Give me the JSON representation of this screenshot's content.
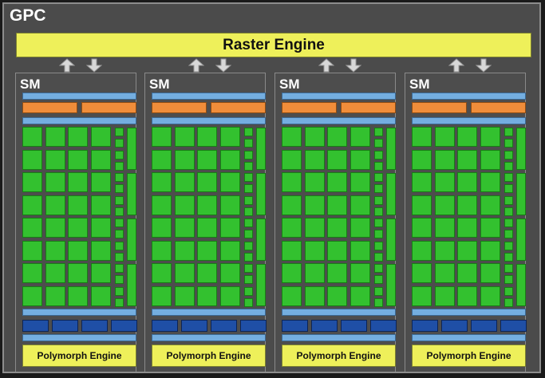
{
  "gpc": {
    "title": "GPC"
  },
  "raster_engine": {
    "label": "Raster Engine"
  },
  "sms": [
    {
      "title": "SM",
      "polymorph_label": "Polymorph Engine"
    },
    {
      "title": "SM",
      "polymorph_label": "Polymorph Engine"
    },
    {
      "title": "SM",
      "polymorph_label": "Polymorph Engine"
    },
    {
      "title": "SM",
      "polymorph_label": "Polymorph Engine"
    }
  ],
  "colors": {
    "background": "#4b4b4b",
    "raster_polymorph": "#eef05a",
    "core": "#33c12f",
    "cache_bar": "#74aee0",
    "warp_scheduler": "#f08d3a",
    "texture_unit": "#1f4fa6"
  },
  "icons": {
    "up": "arrow-up-icon",
    "down": "arrow-down-icon"
  }
}
